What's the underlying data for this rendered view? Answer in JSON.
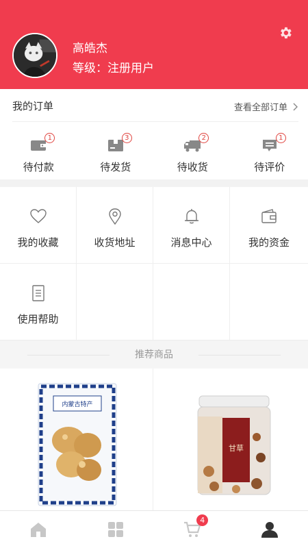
{
  "profile": {
    "name": "高皓杰",
    "level": "等级：注册用户"
  },
  "colors": {
    "brand": "#f03c4e",
    "badge_outline": "#e0443f",
    "icon_gray": "#888888"
  },
  "orders": {
    "title": "我的订单",
    "view_all": "查看全部订单",
    "items": [
      {
        "label": "待付款",
        "count": "1",
        "icon": "wallet-icon"
      },
      {
        "label": "待发货",
        "count": "3",
        "icon": "package-icon"
      },
      {
        "label": "待收货",
        "count": "2",
        "icon": "truck-icon"
      },
      {
        "label": "待评价",
        "count": "1",
        "icon": "comment-icon"
      }
    ]
  },
  "services": [
    {
      "label": "我的收藏",
      "icon": "heart-icon"
    },
    {
      "label": "收货地址",
      "icon": "location-pin-icon"
    },
    {
      "label": "消息中心",
      "icon": "bell-icon"
    },
    {
      "label": "我的资金",
      "icon": "wallet-icon"
    },
    {
      "label": "使用帮助",
      "icon": "document-icon"
    }
  ],
  "recommend": {
    "title": "推荐商品",
    "products": [
      {
        "package_text": "内蒙古特产"
      },
      {
        "package_text": "甘草"
      }
    ]
  },
  "tabbar": {
    "tabs": [
      {
        "icon": "home-icon"
      },
      {
        "icon": "category-icon"
      },
      {
        "icon": "cart-icon"
      },
      {
        "icon": "user-icon"
      }
    ],
    "cart_count": "4"
  }
}
